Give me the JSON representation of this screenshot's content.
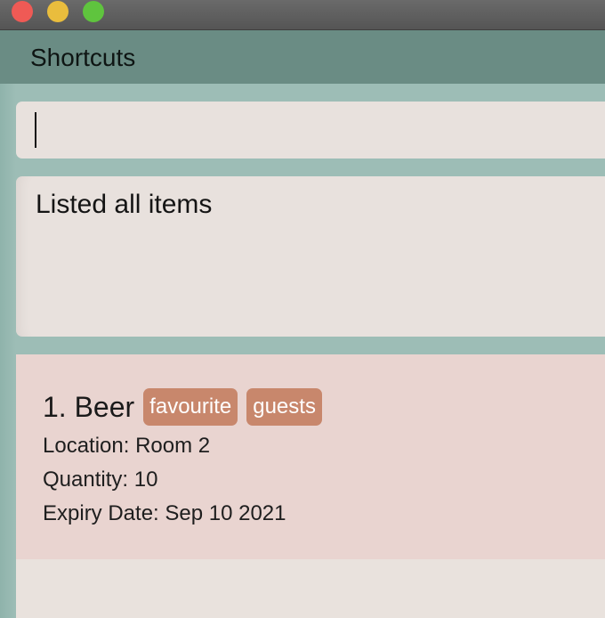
{
  "window": {
    "controls": [
      "close",
      "minimize",
      "zoom"
    ]
  },
  "menubar": {
    "title": "Shortcuts"
  },
  "command": {
    "value": ""
  },
  "result": {
    "message": "Listed all items"
  },
  "items": [
    {
      "title": "1. Beer",
      "tags": [
        "favourite",
        "guests"
      ],
      "location": "Location: Room 2",
      "quantity": "Quantity: 10",
      "expiry": "Expiry Date: Sep 10 2021"
    }
  ],
  "colors": {
    "background": "#9dbdb6",
    "menubar": "#6a8c84",
    "panel": "#e8e1dd",
    "card": "#e9d4d0",
    "tag": "#c8876c"
  }
}
